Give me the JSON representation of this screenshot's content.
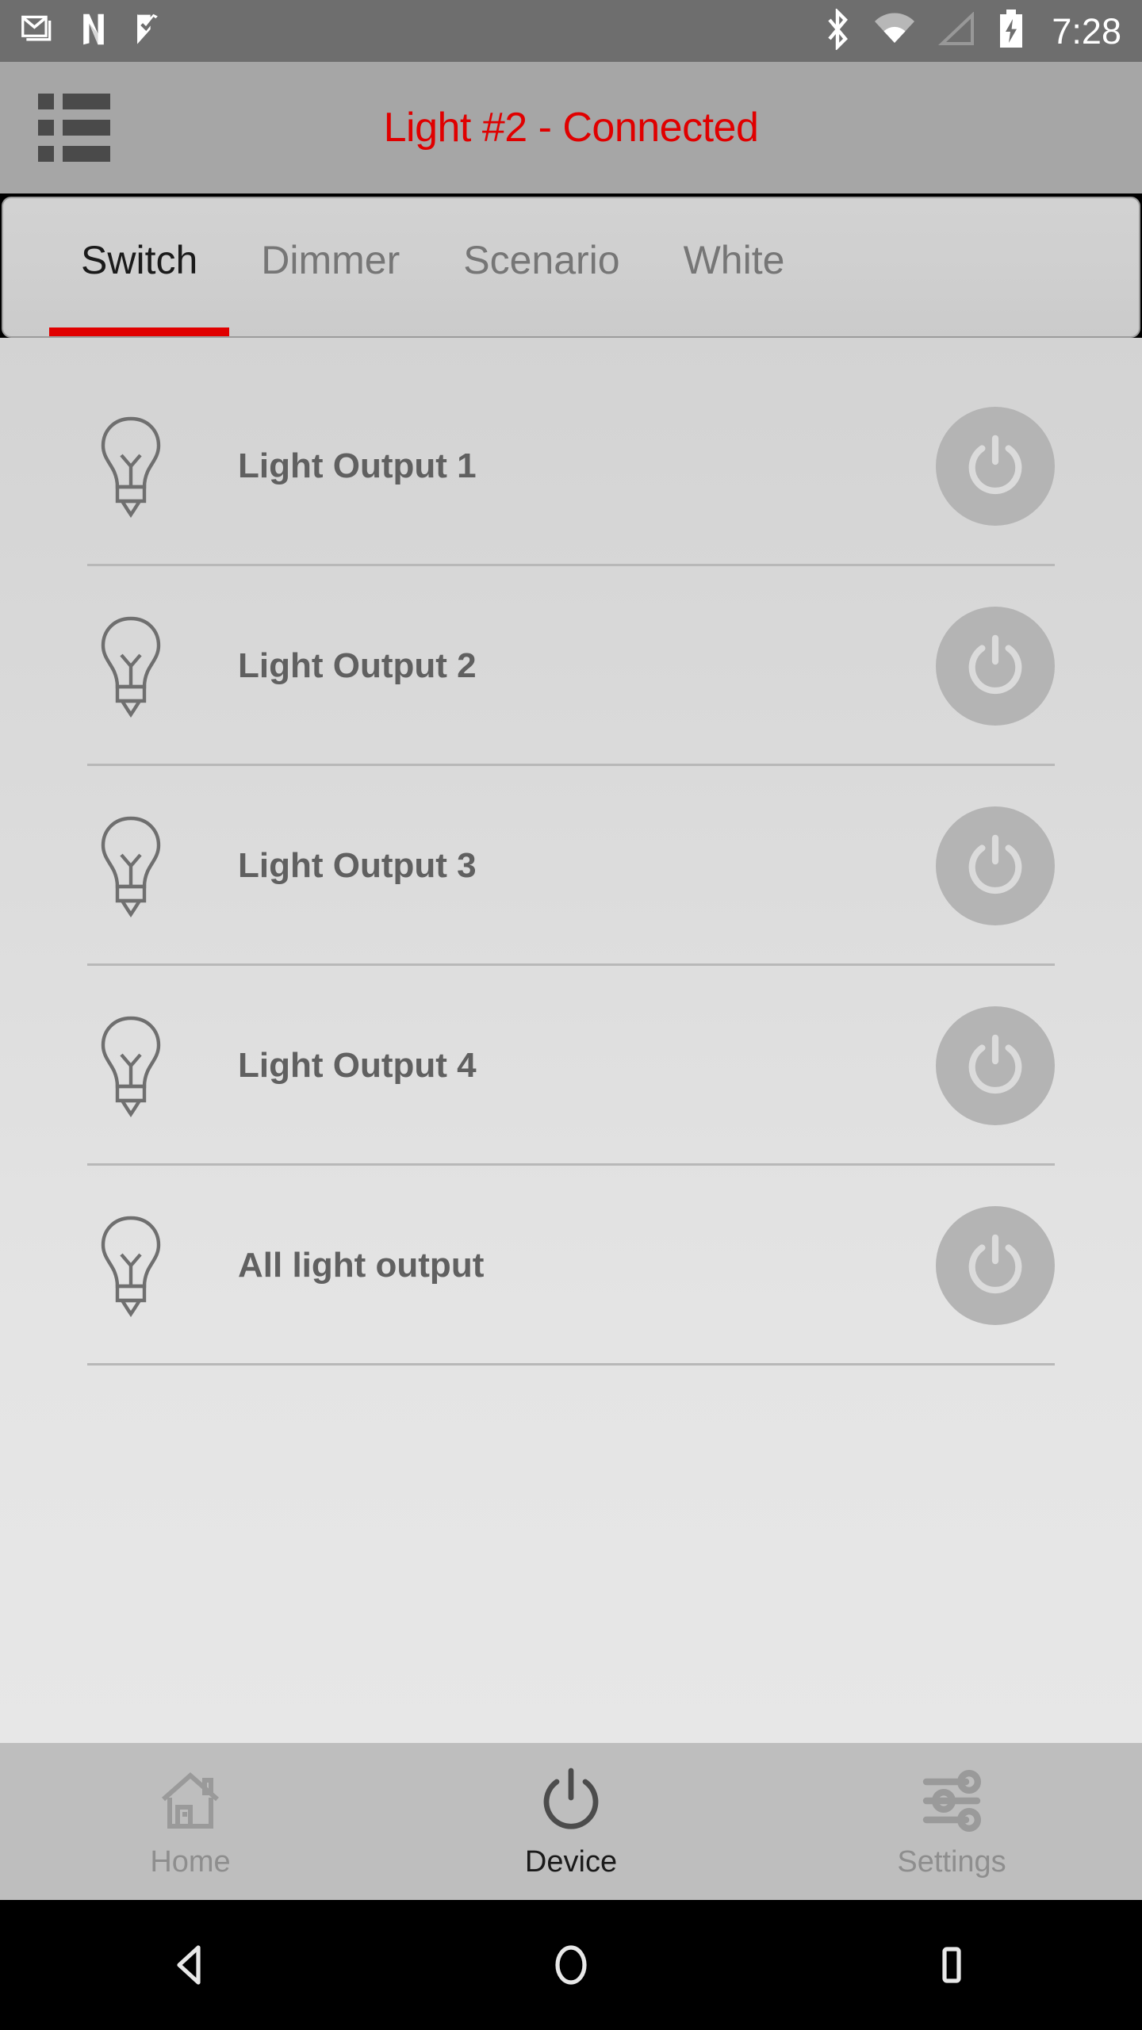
{
  "statusbar": {
    "time": "7:28",
    "left_icons": [
      "gmail-icon",
      "netflix-icon",
      "app-icon"
    ],
    "right_icons": [
      "bluetooth-icon",
      "wifi-icon",
      "cellular-signal-icon",
      "battery-charging-icon"
    ]
  },
  "appbar": {
    "menu_icon": "list-menu-icon",
    "title": "Light #2 - Connected",
    "title_color": "#e00000"
  },
  "tabs": {
    "items": [
      {
        "label": "Switch",
        "active": true
      },
      {
        "label": "Dimmer",
        "active": false
      },
      {
        "label": "Scenario",
        "active": false
      },
      {
        "label": "White",
        "active": false
      }
    ],
    "indicator_color": "#e00000"
  },
  "list": {
    "rows": [
      {
        "icon": "lightbulb-icon",
        "label": "Light Output 1",
        "toggle": "power-button",
        "state": "off"
      },
      {
        "icon": "lightbulb-icon",
        "label": "Light Output 2",
        "toggle": "power-button",
        "state": "off"
      },
      {
        "icon": "lightbulb-icon",
        "label": "Light Output 3",
        "toggle": "power-button",
        "state": "off"
      },
      {
        "icon": "lightbulb-icon",
        "label": "Light Output 4",
        "toggle": "power-button",
        "state": "off"
      },
      {
        "icon": "lightbulb-icon",
        "label": "All light output",
        "toggle": "power-button",
        "state": "off"
      }
    ]
  },
  "bottomnav": {
    "items": [
      {
        "label": "Home",
        "icon": "house-icon",
        "active": false
      },
      {
        "label": "Device",
        "icon": "power-icon",
        "active": true
      },
      {
        "label": "Settings",
        "icon": "sliders-icon",
        "active": false
      }
    ]
  },
  "sysnav": {
    "buttons": [
      "back-triangle-icon",
      "home-circle-icon",
      "recents-square-icon"
    ]
  },
  "colors": {
    "accent_red": "#e00000",
    "statusbar_bg": "#6e6e6e",
    "appbar_bg": "#a6a6a6",
    "bottomnav_bg": "#bebebe",
    "toggle_bg": "#b4b4b4"
  }
}
